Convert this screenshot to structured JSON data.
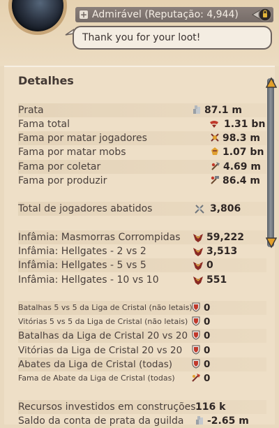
{
  "header": {
    "reputation_text": "Admirável (Reputação: 4,944)",
    "bubble_message": "Thank you for your loot!"
  },
  "panel": {
    "title": "Detalhes",
    "rows": [
      {
        "label": "Prata",
        "value": "87.1 m",
        "icon": "silver-icon"
      },
      {
        "label": "Fama total",
        "value": "1.31 bn",
        "icon": "fame-total-icon"
      },
      {
        "label": "Fama por matar jogadores",
        "value": "98.3 m",
        "icon": "pvp-fame-icon"
      },
      {
        "label": "Fama por matar mobs",
        "value": "1.07 bn",
        "icon": "pve-fame-icon"
      },
      {
        "label": "Fama por coletar",
        "value": "4.69 m",
        "icon": "gathering-fame-icon"
      },
      {
        "label": "Fama por produzir",
        "value": "86.4 m",
        "icon": "crafting-fame-icon"
      },
      {
        "label": "Total de jogadores abatidos",
        "value": "3,806",
        "icon": "kills-icon"
      },
      {
        "label": "Infâmia: Masmorras Corrompidas",
        "value": "59,222",
        "icon": "infamy-icon"
      },
      {
        "label": "Infâmia: Hellgates - 2 vs 2",
        "value": "3,513",
        "icon": "infamy-icon"
      },
      {
        "label": "Infâmia: Hellgates - 5 vs 5",
        "value": "0",
        "icon": "infamy-icon"
      },
      {
        "label": "Infâmia: Hellgates - 10 vs 10",
        "value": "551",
        "icon": "infamy-icon"
      },
      {
        "label": "Batalhas 5 vs 5 da Liga de Cristal (não letais)",
        "value": "0",
        "icon": "crystal-shield-icon"
      },
      {
        "label": "Vitórias 5 vs 5 da Liga de Cristal (não letais)",
        "value": "0",
        "icon": "crystal-shield-icon"
      },
      {
        "label": "Batalhas da Liga de Cristal 20 vs 20",
        "value": "0",
        "icon": "crystal-shield-icon"
      },
      {
        "label": "Vitórias da Liga de Cristal 20 vs 20",
        "value": "0",
        "icon": "crystal-shield-icon"
      },
      {
        "label": "Abates da Liga de Cristal (todas)",
        "value": "0",
        "icon": "crystal-shield-icon"
      },
      {
        "label": "Fama de Abate da Liga de Cristal (todas)",
        "value": "0",
        "icon": "crystal-fame-icon"
      },
      {
        "label": "Recursos investidos em construções",
        "value": "116 k",
        "icon": ""
      },
      {
        "label": "Saldo da conta de prata da guilda",
        "value": "-2.65 m",
        "icon": "silver-icon"
      }
    ]
  },
  "colors": {
    "panel_bg": "#eedfc7",
    "reputation_bar": "#7f7570",
    "scroll_arrow": "#e3a12a"
  }
}
